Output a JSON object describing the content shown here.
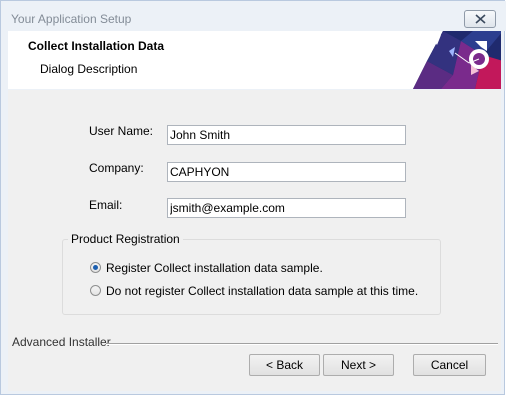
{
  "window": {
    "title": "Your Application Setup"
  },
  "header": {
    "title": "Collect Installation Data",
    "description": "Dialog Description"
  },
  "form": {
    "user_name_label": "User Name:",
    "user_name_value": "John Smith",
    "company_label": "Company:",
    "company_value": "CAPHYON",
    "email_label": "Email:",
    "email_value": "jsmith@example.com"
  },
  "registration": {
    "group_label": "Product Registration",
    "options": [
      {
        "label": "Register Collect installation data sample.",
        "selected": true
      },
      {
        "label": "Do not register Collect installation data sample at this time.",
        "selected": false
      }
    ]
  },
  "footer": {
    "brand": "Advanced Installer",
    "back_label": "< Back",
    "next_label": "Next >",
    "cancel_label": "Cancel"
  },
  "icons": {
    "close": "close-icon",
    "logo": "installer-logo"
  },
  "colors": {
    "radio_accent": "#1c5fb0",
    "logo_navy": "#1f2a6e",
    "logo_purple": "#7a2a8c",
    "logo_magenta": "#c2185b"
  }
}
